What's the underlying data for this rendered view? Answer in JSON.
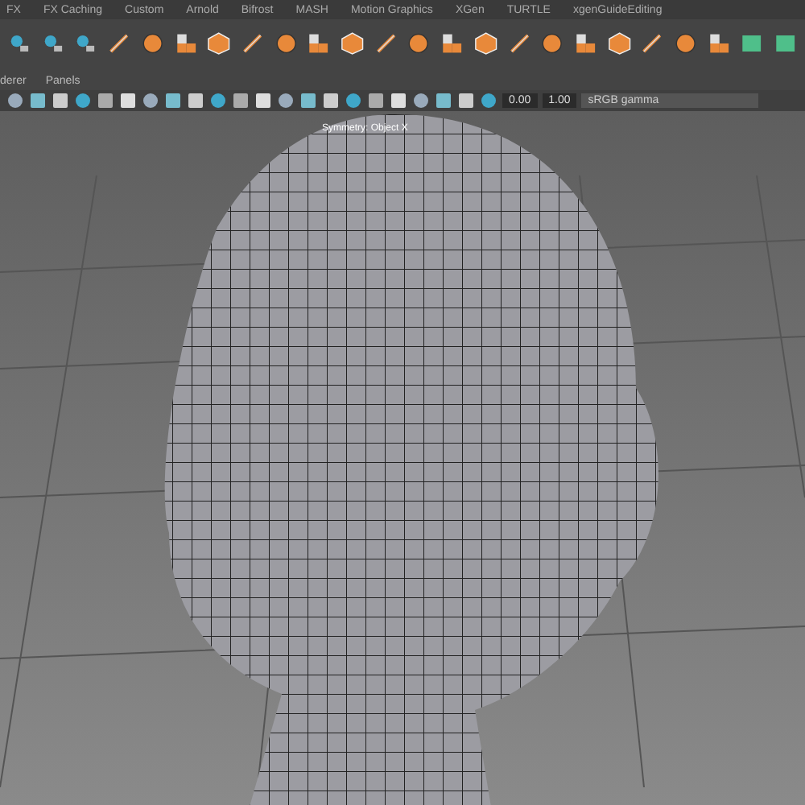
{
  "shelf_tabs": [
    "FX",
    "FX Caching",
    "Custom",
    "Arnold",
    "Bifrost",
    "MASH",
    "Motion Graphics",
    "XGen",
    "TURTLE",
    "xgenGuideEditing"
  ],
  "panel_menu": [
    "derer",
    "Panels"
  ],
  "view_toolbar": {
    "field_1": "0.00",
    "field_2": "1.00",
    "color_space": "sRGB gamma"
  },
  "viewport": {
    "hud_text": "Symmetry: Object X"
  }
}
